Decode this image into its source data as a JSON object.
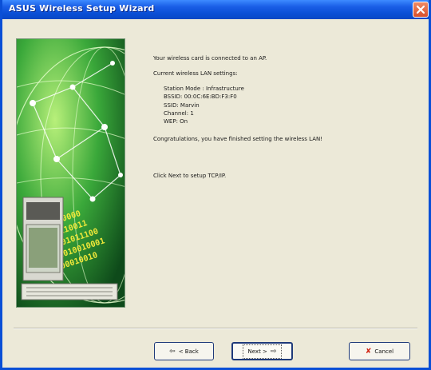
{
  "window": {
    "title": "ASUS Wireless Setup Wizard",
    "close_icon": "close-x-icon",
    "accent": "#0a4fd6"
  },
  "content": {
    "status": "Your wireless card is connected to an AP.",
    "settings_heading": "Current wireless LAN settings:",
    "settings": [
      "Station Mode : Infrastructure",
      "BSSID:  00:0C:6E:BD:F3:F0",
      "SSID:  Marvin",
      "Channel:  1",
      "WEP:  On"
    ],
    "congrats": "Congratulations, you have finished setting the wireless LAN!",
    "next_hint": "Click Next to setup TCP/IP."
  },
  "buttons": {
    "back_label": "< Back",
    "next_label": "Next >",
    "cancel_label": "Cancel"
  },
  "art": {
    "binary_lines": [
      "10001010000",
      "001000110011",
      "1000101011100",
      "00011010010001",
      "01100010010"
    ]
  }
}
